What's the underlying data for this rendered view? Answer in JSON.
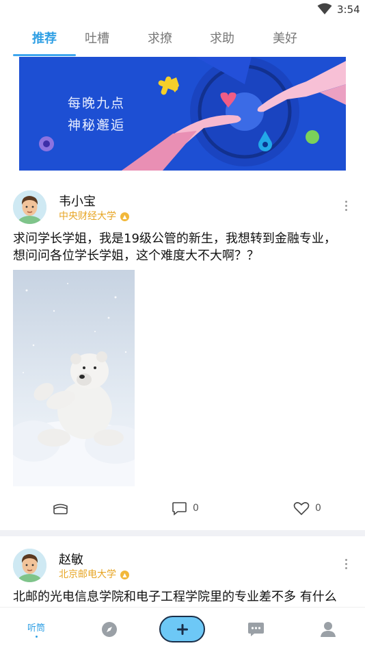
{
  "status_bar": {
    "time": "3:54"
  },
  "tabs": [
    {
      "label": "推荐",
      "active": true
    },
    {
      "label": "吐槽",
      "active": false
    },
    {
      "label": "求撩",
      "active": false
    },
    {
      "label": "求助",
      "active": false
    },
    {
      "label": "美好",
      "active": false
    }
  ],
  "banner": {
    "line1": "每晚九点",
    "line2": "神秘邂逅"
  },
  "posts": [
    {
      "username": "韦小宝",
      "school": "中央财经大学",
      "text": "求问学长学姐，我是19级公管的新生，我想转到金融专业，想问问各位学长学姐，这个难度大不大啊？？",
      "image": "polar-bear-in-snow",
      "comments": "0",
      "likes": "0"
    },
    {
      "username": "赵敏",
      "school": "北京邮电大学",
      "text": "北邮的光电信息学院和电子工程学院里的专业差不多 有什么区别吗"
    }
  ],
  "bottom_nav": {
    "home_label": "听筒",
    "items": [
      "home",
      "discover-icon",
      "add-button",
      "message-icon",
      "profile-icon"
    ]
  },
  "colors": {
    "accent": "#2f9fe4",
    "school": "#e7a524",
    "banner": "#1d4fd3",
    "add_button": "#6dc8f6"
  }
}
